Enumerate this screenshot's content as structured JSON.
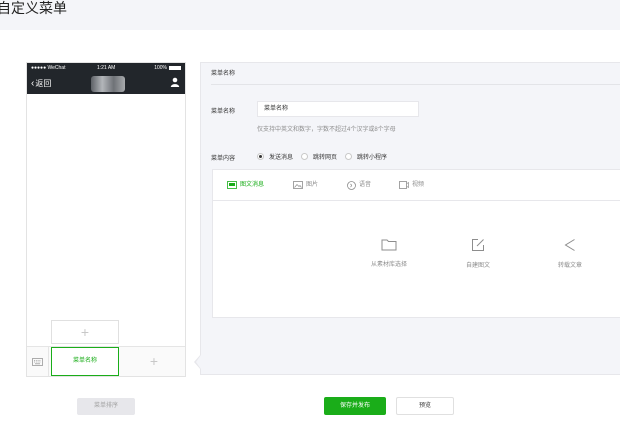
{
  "page": {
    "title": "自定义菜单"
  },
  "phone": {
    "carrier": "●●●●● WeChat",
    "time": "1:21 AM",
    "battery": "100%",
    "back_label": "返回",
    "add_submenu_label": "+",
    "menu_item_label": "菜单名称",
    "add_menu_label": "+"
  },
  "sort_button": "菜单排序",
  "editor": {
    "header": "菜单名称",
    "name_label": "菜单名称",
    "name_value": "菜单名称",
    "hint": "仅支持中英文和数字，字数不超过4个汉字或8个字母",
    "content_label": "菜单内容",
    "radios": [
      {
        "label": "发送消息",
        "checked": true
      },
      {
        "label": "跳转网页",
        "checked": false
      },
      {
        "label": "跳转小程序",
        "checked": false
      }
    ],
    "tabs": [
      {
        "label": "图文消息",
        "icon": "news-icon",
        "active": true
      },
      {
        "label": "图片",
        "icon": "image-icon",
        "active": false
      },
      {
        "label": "语音",
        "icon": "voice-icon",
        "active": false
      },
      {
        "label": "视频",
        "icon": "video-icon",
        "active": false
      }
    ],
    "actions": [
      {
        "label": "从素材库选择",
        "icon": "folder-icon"
      },
      {
        "label": "自建图文",
        "icon": "edit-icon"
      },
      {
        "label": "转载文章",
        "icon": "share-icon"
      }
    ]
  },
  "buttons": {
    "publish": "保存并发布",
    "preview": "预览"
  },
  "colors": {
    "accent": "#1aad19",
    "panel_bg": "#f4f5f9",
    "header_dark": "#22262b"
  }
}
